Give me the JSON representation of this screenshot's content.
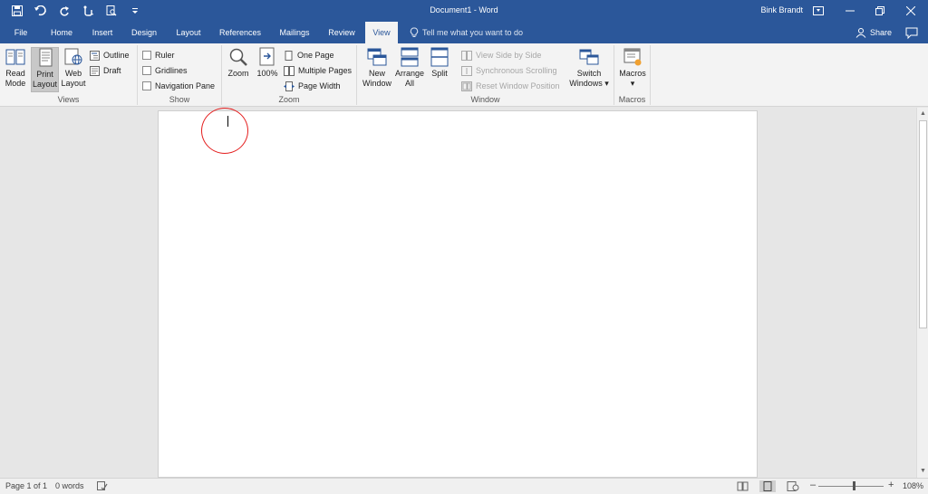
{
  "titlebar": {
    "document_title": "Document1 - Word",
    "user_name": "Bink Brandt",
    "qat_icons": [
      "save-icon",
      "undo-icon",
      "redo-icon",
      "touch-mode-icon",
      "print-preview-icon",
      "customize-qat-icon"
    ],
    "window_icons": [
      "ribbon-display-icon",
      "minimize-icon",
      "restore-icon",
      "close-icon"
    ]
  },
  "tabs": {
    "items": [
      "File",
      "Home",
      "Insert",
      "Design",
      "Layout",
      "References",
      "Mailings",
      "Review",
      "View"
    ],
    "active": "View",
    "tell_me": "Tell me what you want to do",
    "share": "Share"
  },
  "ribbon": {
    "views": {
      "label": "Views",
      "read_mode": [
        "Read",
        "Mode"
      ],
      "print_layout": [
        "Print",
        "Layout"
      ],
      "web_layout": [
        "Web",
        "Layout"
      ],
      "outline": "Outline",
      "draft": "Draft"
    },
    "show": {
      "label": "Show",
      "ruler": "Ruler",
      "gridlines": "Gridlines",
      "navigation_pane": "Navigation Pane"
    },
    "zoom": {
      "label": "Zoom",
      "zoom": "Zoom",
      "hundred": "100%",
      "one_page": "One Page",
      "multiple_pages": "Multiple Pages",
      "page_width": "Page Width"
    },
    "window": {
      "label": "Window",
      "new_window": [
        "New",
        "Window"
      ],
      "arrange_all": [
        "Arrange",
        "All"
      ],
      "split": "Split",
      "view_side_by_side": "View Side by Side",
      "synchronous_scrolling": "Synchronous Scrolling",
      "reset_window_position": "Reset Window Position",
      "switch_windows": [
        "Switch",
        "Windows ▾"
      ]
    },
    "macros": {
      "label": "Macros",
      "macros": "Macros"
    }
  },
  "status": {
    "page": "Page 1 of 1",
    "words": "0 words",
    "zoom_percent": "108%",
    "zoom_level": 0.54,
    "minus": "–",
    "plus": "+"
  },
  "colors": {
    "accent": "#2b579a",
    "annotation": "#e41e1e"
  }
}
